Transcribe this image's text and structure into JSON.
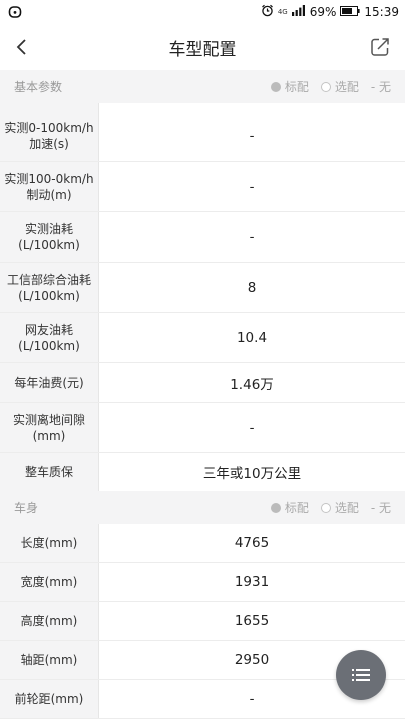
{
  "status_bar": {
    "battery": "69%",
    "time": "15:39",
    "network": "4G"
  },
  "nav": {
    "title": "车型配置"
  },
  "legend": {
    "standard": "标配",
    "optional": "选配",
    "none": "- 无"
  },
  "sections": [
    {
      "title": "基本参数",
      "rows": [
        {
          "label": "实测0-100km/h加速(s)",
          "value": "-"
        },
        {
          "label": "实测100-0km/h制动(m)",
          "value": "-"
        },
        {
          "label": "实测油耗(L/100km)",
          "value": "-"
        },
        {
          "label": "工信部综合油耗(L/100km)",
          "value": "8"
        },
        {
          "label": "网友油耗(L/100km)",
          "value": "10.4"
        },
        {
          "label": "每年油费(元)",
          "value": "1.46万"
        },
        {
          "label": "实测离地间隙(mm)",
          "value": "-"
        },
        {
          "label": "整车质保",
          "value": "三年或10万公里"
        }
      ]
    },
    {
      "title": "车身",
      "rows": [
        {
          "label": "长度(mm)",
          "value": "4765"
        },
        {
          "label": "宽度(mm)",
          "value": "1931"
        },
        {
          "label": "高度(mm)",
          "value": "1655"
        },
        {
          "label": "轴距(mm)",
          "value": "2950"
        },
        {
          "label": "前轮距(mm)",
          "value": "-"
        }
      ]
    }
  ],
  "colors": {
    "background": "#ffffff",
    "label_bg": "#f4f4f5",
    "fab": "#6b6f76"
  }
}
